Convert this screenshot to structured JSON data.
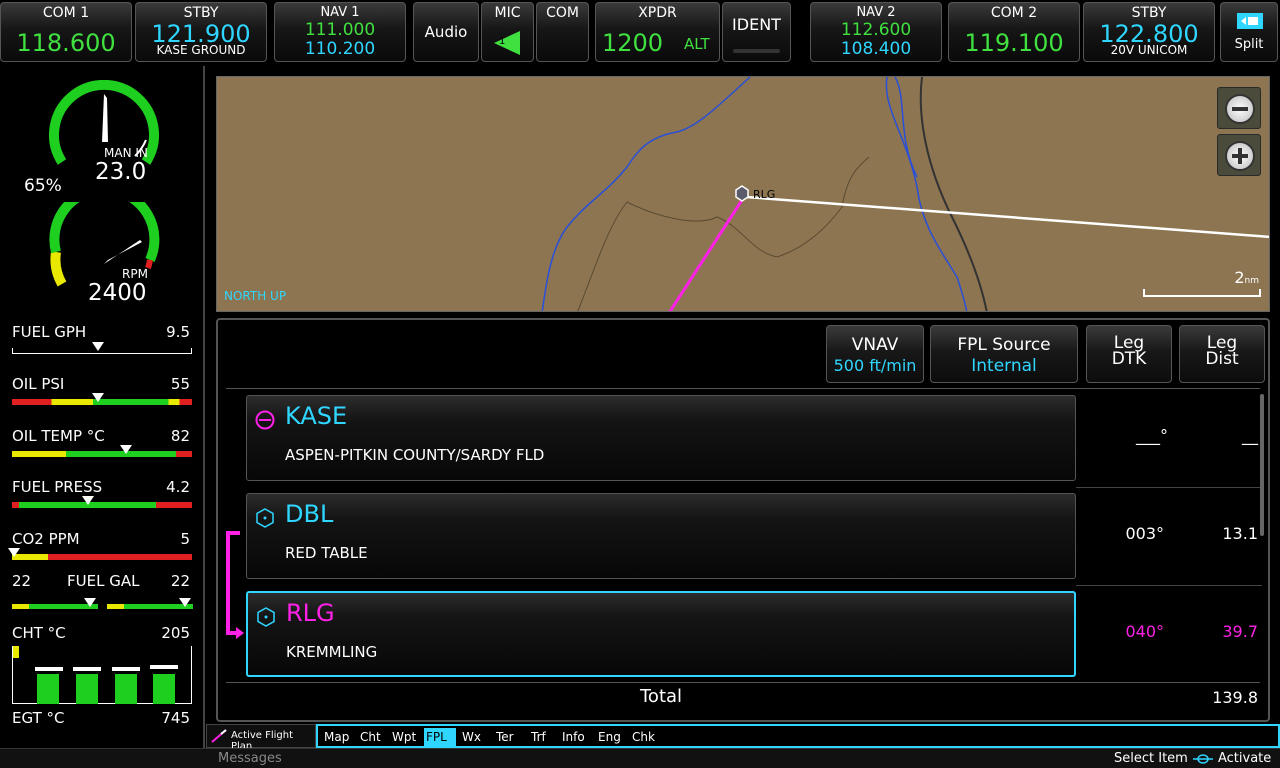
{
  "topbar": {
    "com1": {
      "label": "COM 1",
      "freq": "118.600"
    },
    "com1_stby": {
      "label": "STBY",
      "freq": "121.900",
      "name": "KASE GROUND"
    },
    "nav1": {
      "label": "NAV 1",
      "active": "111.000",
      "standby": "110.200"
    },
    "audio": {
      "audio_label": "Audio",
      "mic_label": "MIC",
      "mic_num": "1",
      "com_label": "COM"
    },
    "xpdr": {
      "label": "XPDR",
      "code": "1200",
      "mode": "ALT",
      "ident": "IDENT"
    },
    "nav2": {
      "label": "NAV 2",
      "active": "112.600",
      "standby": "108.400"
    },
    "com2": {
      "label": "COM 2",
      "freq": "119.100"
    },
    "com2_stby": {
      "label": "STBY",
      "freq": "122.800",
      "name": "20V UNICOM"
    },
    "split": "Split"
  },
  "engine": {
    "man_pct": "65%",
    "man_label": "MAN IN",
    "man_value": "23.0",
    "rpm_label": "RPM",
    "rpm_value": "2400",
    "fuel_gph": {
      "label": "FUEL GPH",
      "value": "9.5"
    },
    "oil_psi": {
      "label": "OIL PSI",
      "value": "55"
    },
    "oil_temp": {
      "label": "OIL TEMP °C",
      "value": "82"
    },
    "fuel_press": {
      "label": "FUEL PRESS",
      "value": "4.2"
    },
    "co2": {
      "label": "CO2 PPM",
      "value": "5"
    },
    "fuel_gal": {
      "label": "FUEL GAL",
      "left": "22",
      "right": "22"
    },
    "cht": {
      "label": "CHT °C",
      "value": "205"
    },
    "egt": {
      "label": "EGT °C",
      "value": "745"
    }
  },
  "map": {
    "north_up": "NORTH UP",
    "waypoint": "RLG",
    "scale": "2",
    "scale_unit": "nm"
  },
  "fpl": {
    "vnav": {
      "label": "VNAV",
      "value": "500 ft/min"
    },
    "source": {
      "label": "FPL Source",
      "value": "Internal"
    },
    "leg_dtk": {
      "l1": "Leg",
      "l2": "DTK"
    },
    "leg_dist": {
      "l1": "Leg",
      "l2": "Dist"
    },
    "rows": [
      {
        "ident": "KASE",
        "name": "ASPEN-PITKIN COUNTY/SARDY FLD",
        "dtk": "___°",
        "dist": "__"
      },
      {
        "ident": "DBL",
        "name": "RED TABLE",
        "dtk": "003°",
        "dist": "13.1"
      },
      {
        "ident": "RLG",
        "name": "KREMMLING",
        "dtk": "040°",
        "dist": "39.7"
      }
    ],
    "total_label": "Total",
    "total_value": "139.8"
  },
  "tabs": {
    "active_fpl": "Active Flight Plan",
    "items": [
      "Map",
      "Cht",
      "Wpt",
      "FPL",
      "Wx",
      "Ter",
      "Trf",
      "Info",
      "Eng",
      "Chk"
    ]
  },
  "status": {
    "messages": "Messages",
    "select": "Select Item",
    "activate": "Activate"
  },
  "colors": {
    "cyan": "#2fd6ff",
    "green": "#3fe03f",
    "magenta": "#ff22e6",
    "terrain": "#8c7550"
  }
}
